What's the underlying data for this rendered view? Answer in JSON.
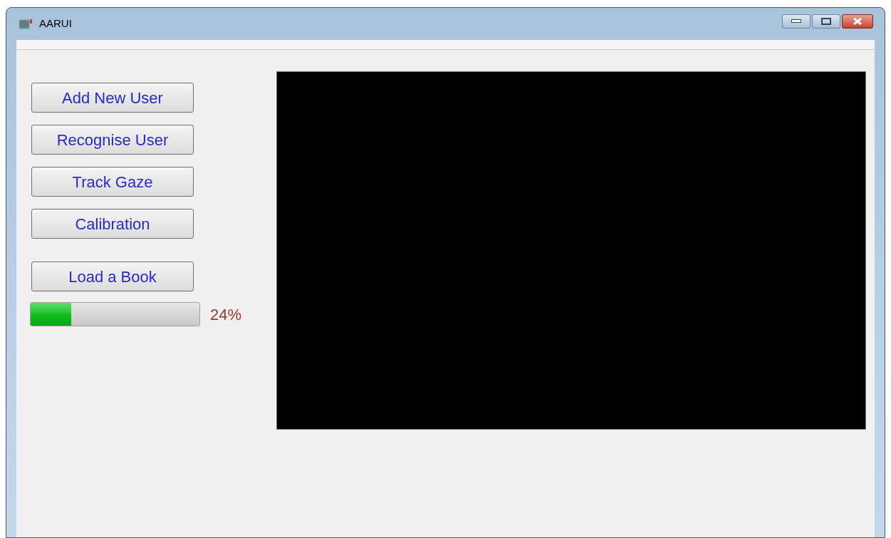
{
  "window": {
    "title": "AARUI"
  },
  "buttons": [
    "Add New User",
    "Recognise User",
    "Track Gaze",
    "Calibration"
  ],
  "load_button": "Load a Book",
  "progress": {
    "level": 0.24,
    "reading": "24%"
  }
}
